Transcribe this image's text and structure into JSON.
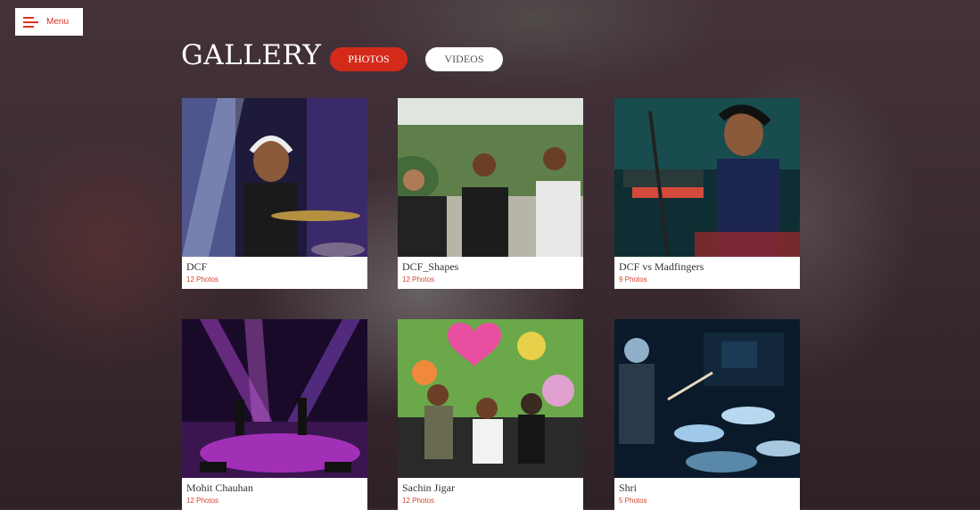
{
  "menu": {
    "label": "Menu",
    "icon": "hamburger-menu-icon"
  },
  "page": {
    "title": "GALLERY"
  },
  "tabs": [
    {
      "label": "PHOTOS",
      "active": true
    },
    {
      "label": "VIDEOS",
      "active": false
    }
  ],
  "albums": [
    {
      "name": "DCF",
      "count": "12 Photos"
    },
    {
      "name": "DCF_Shapes",
      "count": "12 Photos"
    },
    {
      "name": "DCF vs Madfingers",
      "count": "9 Photos"
    },
    {
      "name": "Mohit Chauhan",
      "count": "12 Photos"
    },
    {
      "name": "Sachin Jigar",
      "count": "12 Photos"
    },
    {
      "name": "Shri",
      "count": "5 Photos"
    }
  ],
  "colors": {
    "accent": "#d42a1a",
    "text_accent": "#d9432f",
    "background": "#3b2a30"
  }
}
